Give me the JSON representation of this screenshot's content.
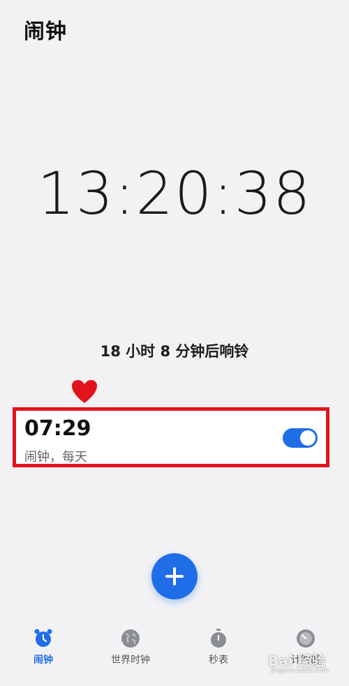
{
  "header": {
    "title": "闹钟"
  },
  "clock": {
    "time": "13:20:38"
  },
  "next_alarm_text": "18 小时 8 分钟后响铃",
  "alarm": {
    "time": "07:29",
    "subtitle": "闹钟，每天",
    "enabled": true
  },
  "fab": {
    "icon": "plus-icon"
  },
  "tabs": [
    {
      "label": "闹钟",
      "icon": "alarm-clock-icon",
      "active": true
    },
    {
      "label": "世界时钟",
      "icon": "globe-icon",
      "active": false
    },
    {
      "label": "秒表",
      "icon": "stopwatch-icon",
      "active": false
    },
    {
      "label": "计时器",
      "icon": "timer-icon",
      "active": false
    }
  ],
  "watermark": {
    "text": "Bai 经验",
    "sub": "jingyan.baidu.com"
  },
  "colors": {
    "accent": "#1f6ee8",
    "highlight_border": "#e2141b",
    "heart": "#e2141b",
    "background": "#f2f2f4"
  }
}
